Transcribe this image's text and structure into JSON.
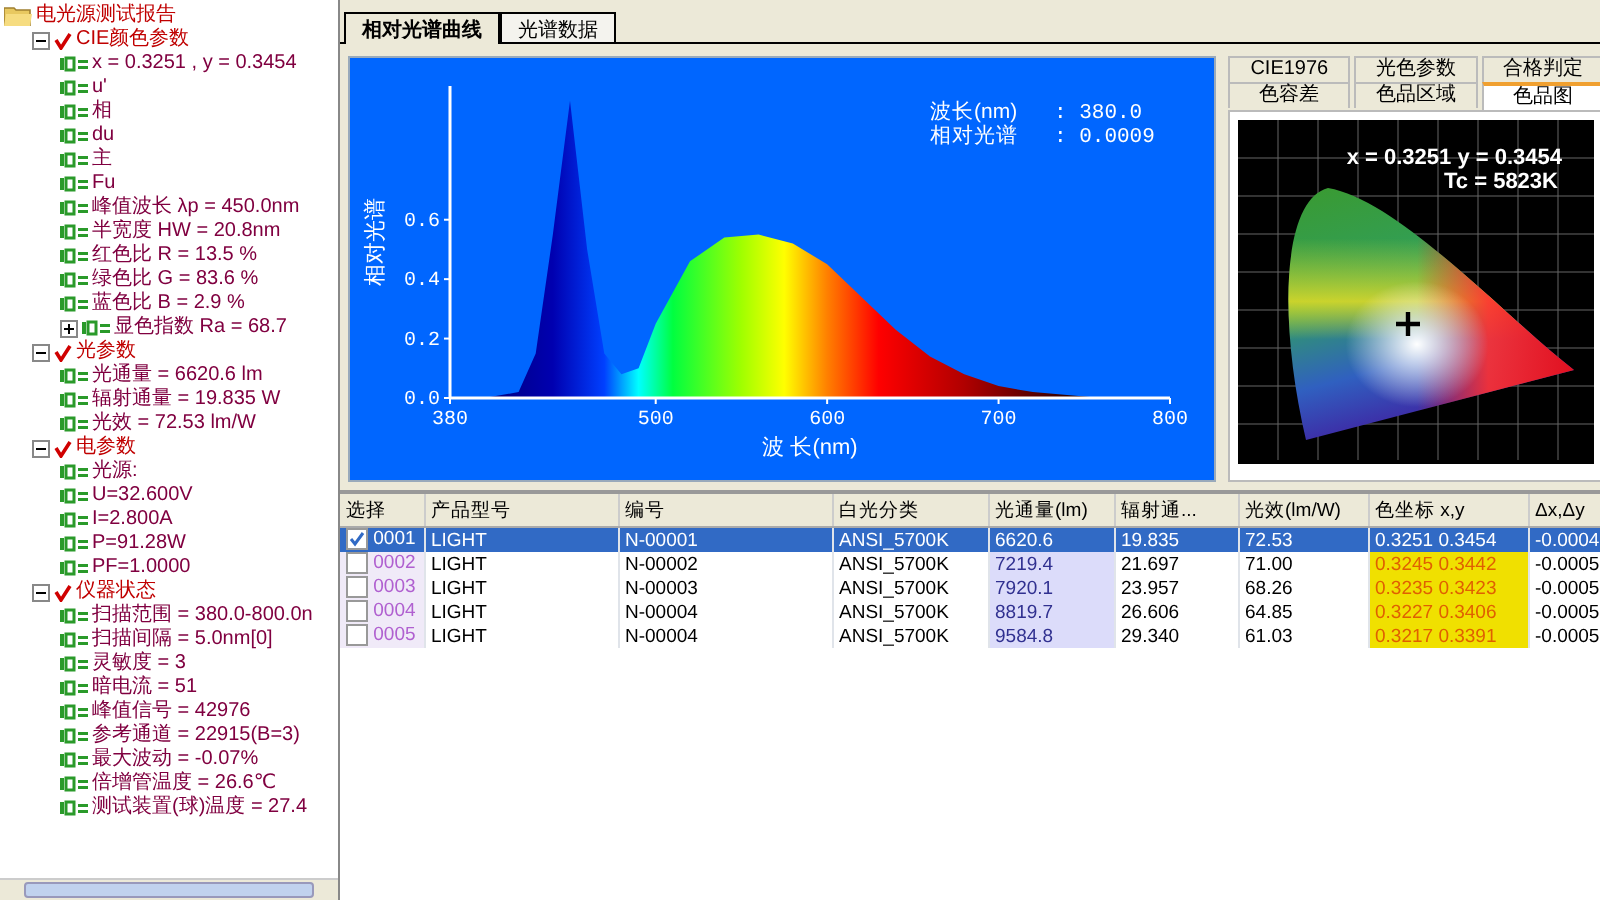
{
  "tree": {
    "label": "电光源测试报告",
    "children": [
      {
        "label": "CIE颜色参数",
        "expanded": true,
        "children": [
          {
            "label": "x = 0.3251 , y = 0.3454"
          },
          {
            "label": "u'"
          },
          {
            "label": "相"
          },
          {
            "label": "du"
          },
          {
            "label": "主"
          },
          {
            "label": "Fu"
          },
          {
            "label": "峰值波长 λp = 450.0nm"
          },
          {
            "label": "半宽度 HW = 20.8nm"
          },
          {
            "label": "红色比 R = 13.5 %"
          },
          {
            "label": "绿色比 G = 83.6 %"
          },
          {
            "label": "蓝色比 B = 2.9 %"
          },
          {
            "label": "显色指数 Ra = 68.7",
            "expanded": false
          }
        ]
      },
      {
        "label": "光参数",
        "expanded": true,
        "children": [
          {
            "label": "光通量 = 6620.6 lm"
          },
          {
            "label": "辐射通量 = 19.835 W"
          },
          {
            "label": "光效 = 72.53 lm/W"
          }
        ]
      },
      {
        "label": "电参数",
        "expanded": true,
        "children": [
          {
            "label": "光源:"
          },
          {
            "label": "U=32.600V"
          },
          {
            "label": "I=2.800A"
          },
          {
            "label": "P=91.28W"
          },
          {
            "label": "PF=1.0000"
          }
        ]
      },
      {
        "label": "仪器状态",
        "expanded": true,
        "children": [
          {
            "label": "扫描范围 = 380.0-800.0n"
          },
          {
            "label": "扫描间隔 = 5.0nm[0]"
          },
          {
            "label": "灵敏度    = 3"
          },
          {
            "label": "暗电流    = 51"
          },
          {
            "label": "峰值信号 = 42976"
          },
          {
            "label": "参考通道 = 22915(B=3)"
          },
          {
            "label": "最大波动 = -0.07%"
          },
          {
            "label": "倍增管温度 = 26.6℃"
          },
          {
            "label": "测试装置(球)温度 = 27.4"
          }
        ]
      }
    ]
  },
  "tabs": [
    {
      "label": "相对光谱曲线",
      "selected": true
    },
    {
      "label": "光谱数据",
      "selected": false
    }
  ],
  "spectrum": {
    "readout": [
      {
        "label": "波长(nm)",
        "value": ": 380.0"
      },
      {
        "label": "相对光谱",
        "value": ": 0.0009"
      }
    ],
    "chart_data": {
      "type": "area",
      "xlabel": "波 长(nm)",
      "ylabel": "相对光谱",
      "x": [
        380,
        400,
        420,
        430,
        440,
        450,
        460,
        470,
        480,
        490,
        500,
        520,
        540,
        560,
        580,
        600,
        620,
        640,
        660,
        680,
        700,
        720,
        740,
        760,
        800
      ],
      "series": [
        {
          "values": [
            0,
            0,
            0.02,
            0.15,
            0.55,
            1.0,
            0.5,
            0.15,
            0.08,
            0.1,
            0.25,
            0.46,
            0.54,
            0.55,
            0.52,
            0.45,
            0.34,
            0.23,
            0.14,
            0.08,
            0.04,
            0.02,
            0.01,
            0,
            0
          ]
        }
      ],
      "xlim": [
        380,
        800
      ],
      "ylim": [
        0,
        1.05
      ],
      "xticks": [
        380,
        500,
        600,
        700,
        800
      ],
      "yticks": [
        {
          "value": 0,
          "label": "0.0"
        },
        {
          "value": 0.2,
          "label": "0.2"
        },
        {
          "value": 0.4,
          "label": "0.4"
        },
        {
          "value": 0.6,
          "label": "0.6"
        }
      ]
    }
  },
  "color_tabs": [
    [
      {
        "label": "CIE1976",
        "selected": false
      },
      {
        "label": "光色参数",
        "selected": false
      },
      {
        "label": "合格判定",
        "selected": false
      }
    ],
    [
      {
        "label": "色容差",
        "selected": false
      },
      {
        "label": "色品区域",
        "selected": false
      },
      {
        "label": "色品图",
        "selected": true
      }
    ]
  ],
  "chromaticity": {
    "coords": "x = 0.3251 y = 0.3454",
    "tc": "Tc = 5823K"
  },
  "table": {
    "columns": [
      "选择",
      "产品型号",
      "编号",
      "白光分类",
      "光通量(lm)",
      "辐射通...",
      "光效(lm/W)",
      "色坐标 x,y",
      "Δx,Δy"
    ],
    "rows": [
      {
        "id": "0001",
        "checked": true,
        "selected": true,
        "model": "LIGHT",
        "number": "N-00001",
        "class": "ANSI_5700K",
        "flux": "6620.6",
        "radiant": "19.835",
        "efficacy": "72.53",
        "xy": "0.3251 0.3454",
        "dxy": "-0.0004"
      },
      {
        "id": "0002",
        "checked": false,
        "selected": false,
        "model": "LIGHT",
        "number": "N-00002",
        "class": "ANSI_5700K",
        "flux": "7219.4",
        "radiant": "21.697",
        "efficacy": "71.00",
        "xy": "0.3245 0.3442",
        "dxy": "-0.0005"
      },
      {
        "id": "0003",
        "checked": false,
        "selected": false,
        "model": "LIGHT",
        "number": "N-00003",
        "class": "ANSI_5700K",
        "flux": "7920.1",
        "radiant": "23.957",
        "efficacy": "68.26",
        "xy": "0.3235 0.3423",
        "dxy": "-0.0005"
      },
      {
        "id": "0004",
        "checked": false,
        "selected": false,
        "model": "LIGHT",
        "number": "N-00004",
        "class": "ANSI_5700K",
        "flux": "8819.7",
        "radiant": "26.606",
        "efficacy": "64.85",
        "xy": "0.3227 0.3406",
        "dxy": "-0.0005"
      },
      {
        "id": "0005",
        "checked": false,
        "selected": false,
        "model": "LIGHT",
        "number": "N-00004",
        "class": "ANSI_5700K",
        "flux": "9584.8",
        "radiant": "29.340",
        "efficacy": "61.03",
        "xy": "0.3217 0.3391",
        "dxy": "-0.0005"
      }
    ]
  }
}
